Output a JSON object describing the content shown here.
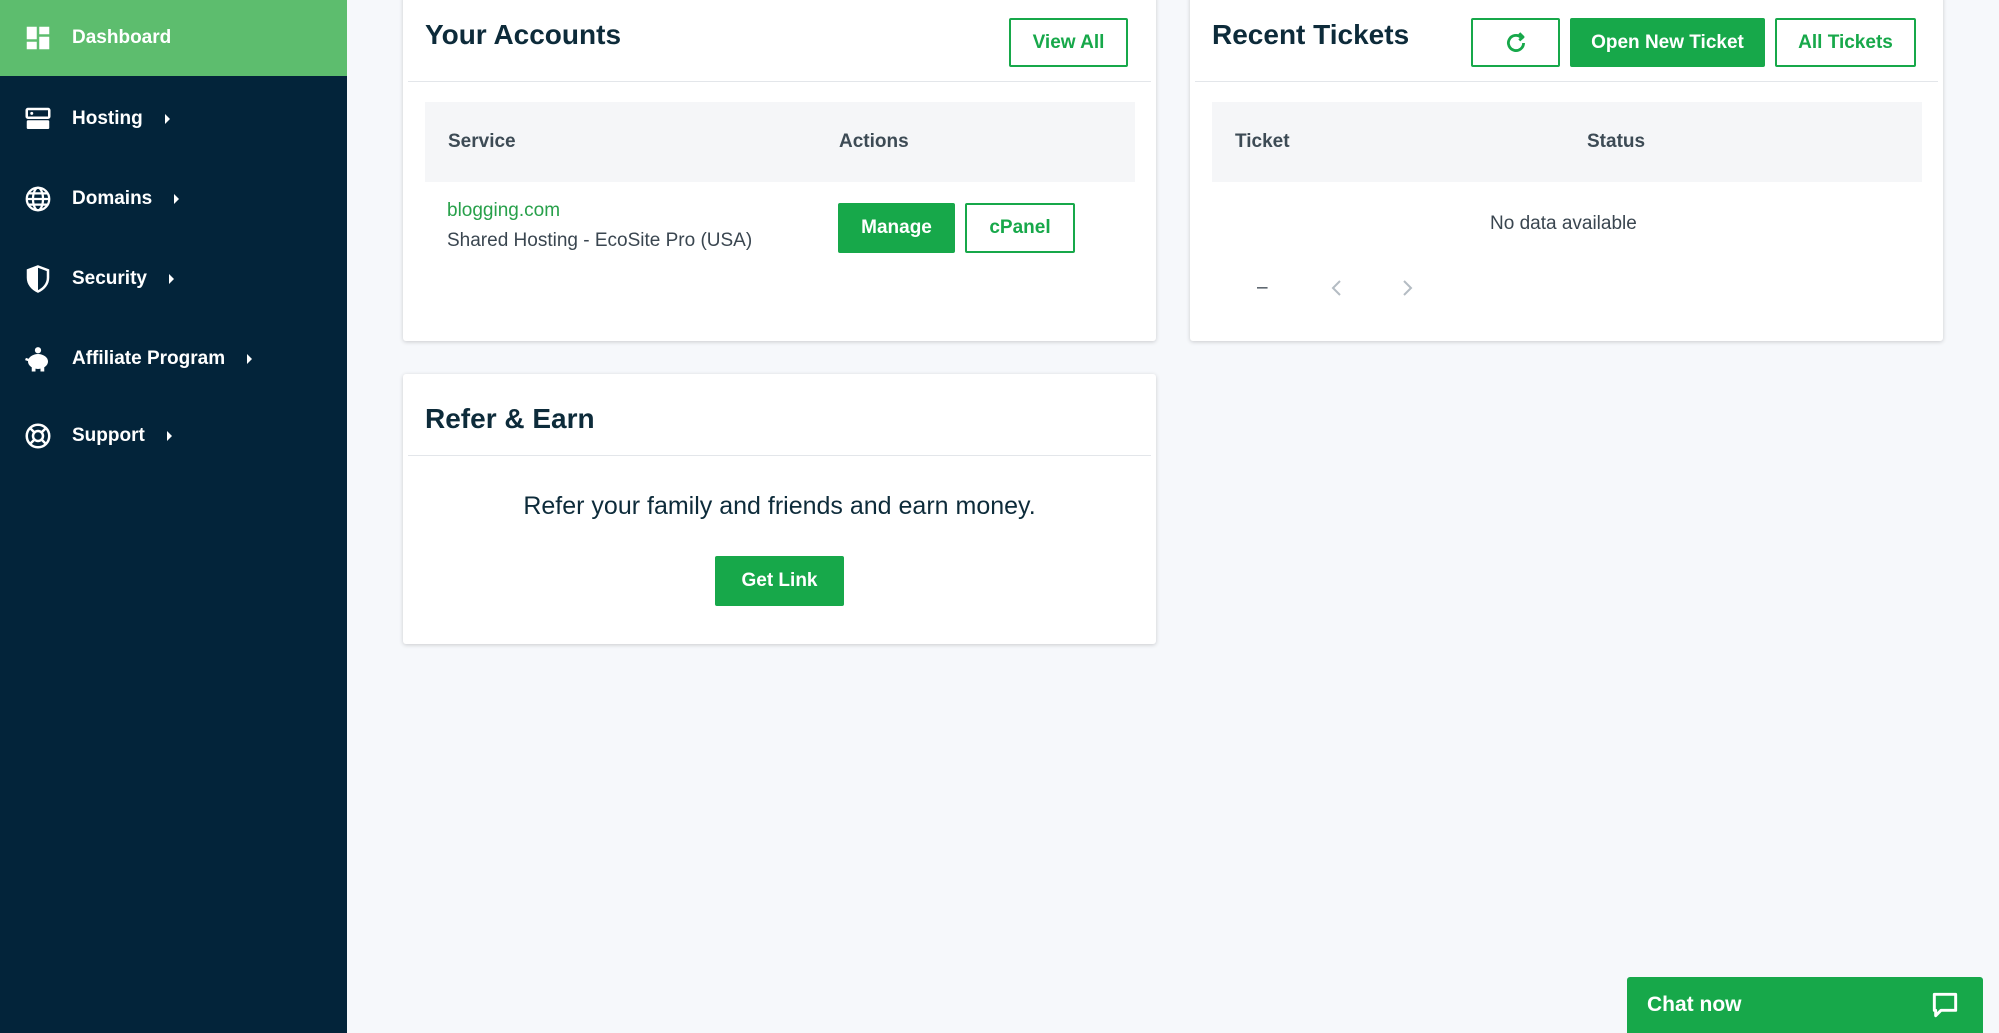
{
  "sidebar": {
    "items": [
      {
        "label": "Dashboard",
        "icon": "dashboard-icon",
        "active": true
      },
      {
        "label": "Hosting",
        "icon": "server-icon"
      },
      {
        "label": "Domains",
        "icon": "globe-icon"
      },
      {
        "label": "Security",
        "icon": "shield-icon"
      },
      {
        "label": "Affiliate Program",
        "icon": "piggy-bank-icon"
      },
      {
        "label": "Support",
        "icon": "lifebuoy-icon"
      }
    ]
  },
  "accounts": {
    "title": "Your Accounts",
    "view_all_label": "View All",
    "columns": [
      "Service",
      "Actions"
    ],
    "rows": [
      {
        "service": "blogging.com",
        "plan": "Shared Hosting - EcoSite Pro (USA)",
        "manage_label": "Manage",
        "cpanel_label": "cPanel"
      }
    ]
  },
  "tickets": {
    "title": "Recent Tickets",
    "open_new_label": "Open New Ticket",
    "all_label": "All Tickets",
    "columns": [
      "Ticket",
      "Status"
    ],
    "empty_text": "No data available",
    "pagination_text": "–"
  },
  "refer": {
    "title": "Refer & Earn",
    "text": "Refer your family and friends and earn money.",
    "button_label": "Get Link"
  },
  "chat": {
    "label": "Chat now"
  },
  "colors": {
    "sidebar_bg": "#03243a",
    "active_bg": "#5dbd6e",
    "accent": "#17a84a"
  }
}
